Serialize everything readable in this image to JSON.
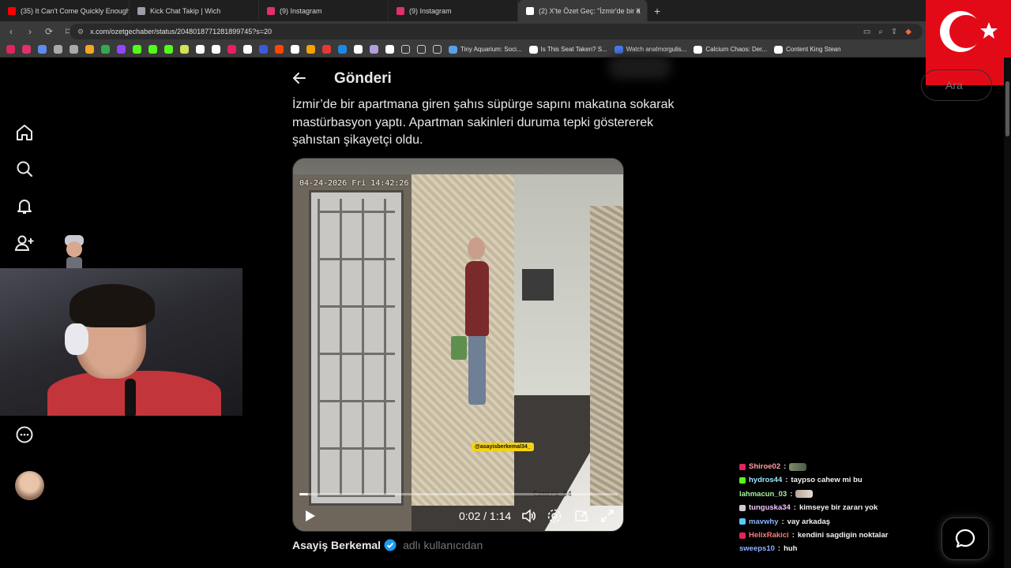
{
  "browser": {
    "tabs": [
      {
        "label": "(35) It Can't Come Quickly Enough -",
        "favicon_color": "#ff0000",
        "active": false
      },
      {
        "label": "Kick Chat Takip | Wich",
        "favicon_color": "#9aa0a6",
        "active": false
      },
      {
        "label": "(9) Instagram",
        "favicon_color": "#e1306c",
        "active": false
      },
      {
        "label": "(9) Instagram",
        "favicon_color": "#e1306c",
        "active": false
      },
      {
        "label": "(2) X'te Özet Geç: \"İzmir'de bir a",
        "favicon_color": "#ffffff",
        "active": true
      }
    ],
    "new_tab_label": "+",
    "url": "x.com/ozetgechaber/status/2048018771281899745?s=20",
    "bookmarks": [
      {
        "label": "Tiny Aquarium: Soci...",
        "icon_color": "#5aa0e8"
      },
      {
        "label": "Is This Seat Taken? S...",
        "icon_color": "#ffffff"
      },
      {
        "label": "Watch analmorgulis...",
        "icon_color": "#4a7bf5"
      },
      {
        "label": "Calcium Chaos: Der...",
        "icon_color": "#ffffff"
      },
      {
        "label": "Content King Stean",
        "icon_color": "#ffffff"
      }
    ],
    "bookmark_icon_colors": [
      "#e0245e",
      "#e1306c",
      "#5b8def",
      "#aaaaaa",
      "#aaaaaa",
      "#f5a623",
      "#34a853",
      "#9146ff",
      "#53fc18",
      "#53fc18",
      "#53fc18",
      "#d4e157",
      "#ffffff",
      "#ffffff",
      "#e91e63",
      "#ffffff",
      "#3b5bdb",
      "#ff4500",
      "#ffffff",
      "#f4a300",
      "#e53935",
      "#1e88e5",
      "#ffffff",
      "#b39ddb",
      "#ffffff",
      "#cccccc",
      "#cccccc",
      "#cccccc"
    ]
  },
  "x_sidebar": {
    "items": [
      {
        "name": "home-icon"
      },
      {
        "name": "search-icon"
      },
      {
        "name": "notifications-icon"
      },
      {
        "name": "follow-icon"
      },
      {
        "name": "more-icon"
      }
    ]
  },
  "search": {
    "placeholder": "Ara"
  },
  "post": {
    "header": "Gönderi",
    "text": "İzmir’de bir apartmana giren şahıs süpürge sapını makatına sokarak mastürbasyon yaptı. Apartman sakinleri duruma tepki göstererek şahıstan şikayetçi oldu.",
    "author_name": "Asayiş Berkemal",
    "author_suffix": "adlı kullanıcıdan"
  },
  "video": {
    "cctv_timestamp": "04-24-2026 Fri 14:42:26",
    "camera_label": "Camera 04",
    "watermark": "@asayisberkemal34_",
    "time_display": "0:02 / 1:14",
    "progress_fraction": 0.027
  },
  "chat": {
    "lines": [
      {
        "user": "Shiroe02",
        "user_color": "#ff9fa6",
        "badge_color": "#e0245e",
        "message": "",
        "emote": "tank"
      },
      {
        "user": "hydros44",
        "user_color": "#9ae8ff",
        "badge_color": "#53fc18",
        "message": "taypso cahew mi bu"
      },
      {
        "user": "lahmacun_03",
        "user_color": "#a6f0a0",
        "badge_color": "",
        "message": "",
        "emote": "face"
      },
      {
        "user": "tunguska34",
        "user_color": "#f2c4ff",
        "badge_color": "#cccccc",
        "message": "kimseye bir zararı yok"
      },
      {
        "user": "mavwhy",
        "user_color": "#8ab4ff",
        "badge_color": "#5ac8fa",
        "message": "vay arkadaş"
      },
      {
        "user": "HelixRakici",
        "user_color": "#ff7b7b",
        "badge_color": "#e0245e",
        "message": "kendini sagdigin noktalar"
      },
      {
        "user": "sweeps10",
        "user_color": "#8ab4ff",
        "badge_color": "",
        "message": "huh"
      }
    ]
  },
  "colors": {
    "x_background": "#000000",
    "x_text": "#e7e9ea",
    "x_muted": "#71767b",
    "verified": "#1d9bf0",
    "flag_red": "#e30a17",
    "watermark_yellow": "#f5d212"
  }
}
